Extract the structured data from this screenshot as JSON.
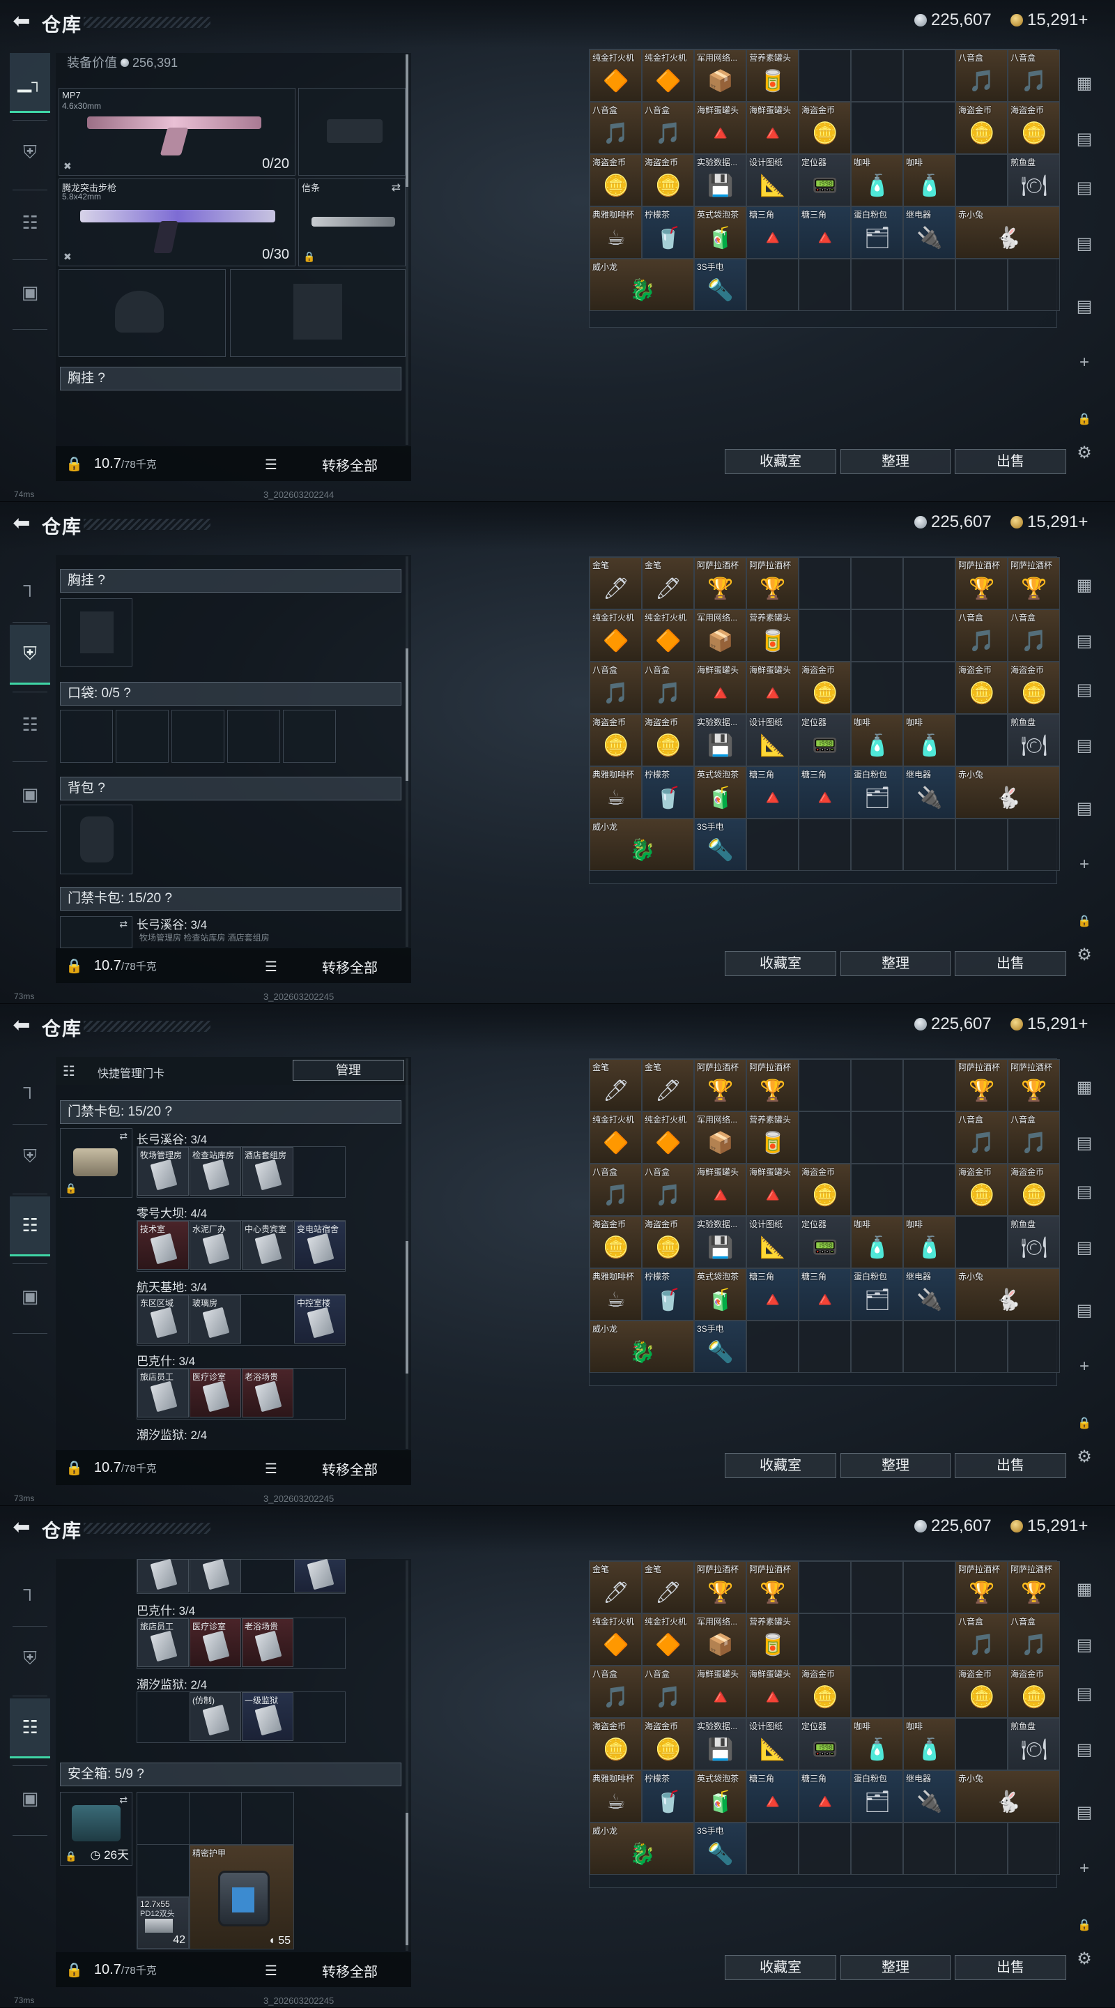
{
  "app": {
    "title": "仓库",
    "currency_silver": "225,607",
    "currency_gold": "15,291+",
    "fps": [
      "74ms",
      "73ms",
      "73ms",
      "73ms"
    ],
    "build": [
      "3_202603202244",
      "3_202603202245",
      "3_202603202245",
      "3_202603202245"
    ]
  },
  "left_nav": [
    "weapon-tab",
    "armor-tab",
    "clipboard-tab",
    "briefcase-tab"
  ],
  "screen1": {
    "value_label": "装备价值",
    "value": "256,391",
    "slot1_name": "MP7",
    "slot1_ammo_type": "4.6x30mm",
    "slot1_ammo": "0/20",
    "slot2_name": "腾龙突击步枪",
    "slot2_ammo_type": "5.8x42mm",
    "slot2_ammo": "0/30",
    "knife_name": "信条",
    "chest_label": "胸挂 ?"
  },
  "screen2": {
    "chest_label": "胸挂 ?",
    "pocket_label": "口袋: 0/5 ?",
    "backpack_label": "背包 ?",
    "card_label": "门禁卡包: 15/20 ?",
    "sub_label": "长弓溪谷: 3/4",
    "sub_cards": "牧场管理房  检查站库房  酒店套组房"
  },
  "screen3": {
    "quick_label": "快捷管理门卡",
    "manage_btn": "管理",
    "card_label": "门禁卡包: 15/20 ?",
    "groups": [
      {
        "name": "长弓溪谷: 3/4",
        "cards": [
          "牧场管理房",
          "检查站库房",
          "酒店套组房"
        ],
        "kinds": [
          "white",
          "white",
          "white"
        ]
      },
      {
        "name": "零号大坝: 4/4",
        "cards": [
          "技术室",
          "水泥厂办",
          "中心贵宾室",
          "变电站宿舍"
        ],
        "kinds": [
          "red",
          "white",
          "white",
          "blue"
        ]
      },
      {
        "name": "航天基地: 3/4",
        "cards": [
          "东区区域",
          "玻璃房",
          "",
          "中控室楼"
        ],
        "kinds": [
          "white",
          "white",
          "",
          "blue"
        ]
      },
      {
        "name": "巴克什: 3/4",
        "cards": [
          "旅店员工",
          "医疗诊室",
          "老浴场贵"
        ],
        "kinds": [
          "white",
          "red",
          "red"
        ]
      },
      {
        "name": "潮汐监狱: 2/4",
        "cards": [],
        "kinds": []
      }
    ]
  },
  "screen4": {
    "bakeshi_label": "巴克什: 3/4",
    "bakeshi_cards": [
      "旅店员工",
      "医疗诊室",
      "老浴场贵"
    ],
    "chaoxi_label": "潮汐监狱: 2/4",
    "chaoxi_cards": [
      "(仿制)",
      "一级监狱"
    ],
    "safe_label": "安全箱: 5/9 ?",
    "safe_days": "26天",
    "armor_name": "精密护甲",
    "armor_value": "55",
    "ammo_name": "12.7x55",
    "ammo_sub": "PD12双头",
    "ammo_count": "42"
  },
  "bottom": {
    "weight": "10.7",
    "weight_max": "/78千克",
    "transfer_all": "转移全部"
  },
  "stash_buttons": {
    "collection": "收藏室",
    "sort": "整理",
    "sell": "出售"
  },
  "stash_rows": [
    [
      {
        "label": "金笔",
        "kind": "gold",
        "icon": "🖊"
      },
      {
        "label": "金笔",
        "kind": "gold",
        "icon": "🖊"
      },
      {
        "label": "阿萨拉酒杯",
        "kind": "gold",
        "icon": "🏆"
      },
      {
        "label": "阿萨拉酒杯",
        "kind": "gold",
        "icon": "🏆"
      },
      {
        "label": "",
        "kind": "dark",
        "icon": ""
      },
      {
        "label": "",
        "kind": "dark",
        "icon": ""
      },
      {
        "label": "",
        "kind": "dark",
        "icon": ""
      },
      {
        "label": "阿萨拉酒杯",
        "kind": "gold",
        "icon": "🏆"
      },
      {
        "label": "阿萨拉酒杯",
        "kind": "gold",
        "icon": "🏆"
      }
    ],
    [
      {
        "label": "纯金打火机",
        "kind": "gold",
        "icon": "🔶"
      },
      {
        "label": "纯金打火机",
        "kind": "gold",
        "icon": "🔶"
      },
      {
        "label": "军用网络...",
        "kind": "gold",
        "icon": "📦"
      },
      {
        "label": "营养素罐头",
        "kind": "gold",
        "icon": "🥫"
      },
      {
        "label": "",
        "kind": "dark",
        "icon": ""
      },
      {
        "label": "",
        "kind": "dark",
        "icon": ""
      },
      {
        "label": "",
        "kind": "dark",
        "icon": ""
      },
      {
        "label": "八音盒",
        "kind": "gold",
        "icon": "🎵"
      },
      {
        "label": "八音盒",
        "kind": "gold",
        "icon": "🎵"
      }
    ],
    [
      {
        "label": "八音盒",
        "kind": "gold",
        "icon": "🎵"
      },
      {
        "label": "八音盒",
        "kind": "gold",
        "icon": "🎵"
      },
      {
        "label": "海鲜蛋罐头",
        "kind": "gold",
        "icon": "🔺"
      },
      {
        "label": "海鲜蛋罐头",
        "kind": "gold",
        "icon": "🔺"
      },
      {
        "label": "海盗金币",
        "kind": "gold",
        "icon": "🪙"
      },
      {
        "label": "",
        "kind": "dark",
        "icon": ""
      },
      {
        "label": "",
        "kind": "dark",
        "icon": ""
      },
      {
        "label": "海盗金币",
        "kind": "gold",
        "icon": "🪙"
      },
      {
        "label": "海盗金币",
        "kind": "gold",
        "icon": "🪙"
      }
    ],
    [
      {
        "label": "海盗金币",
        "kind": "gold",
        "icon": "🪙"
      },
      {
        "label": "海盗金币",
        "kind": "gold",
        "icon": "🪙"
      },
      {
        "label": "实验数据...",
        "kind": "white",
        "icon": "💾"
      },
      {
        "label": "设计图纸",
        "kind": "white",
        "icon": "📐"
      },
      {
        "label": "定位器",
        "kind": "white",
        "icon": "📟"
      },
      {
        "label": "咖啡",
        "kind": "gold",
        "icon": "🧴"
      },
      {
        "label": "咖啡",
        "kind": "gold",
        "icon": "🧴"
      },
      {
        "label": "",
        "kind": "dark",
        "icon": ""
      },
      {
        "label": "煎鱼盘",
        "kind": "white",
        "icon": "🍽"
      }
    ],
    [
      {
        "label": "典雅咖啡杯",
        "kind": "gold",
        "icon": "☕"
      },
      {
        "label": "柠檬茶",
        "kind": "blue",
        "icon": "🥤"
      },
      {
        "label": "英式袋泡茶",
        "kind": "gold",
        "icon": "🧃"
      },
      {
        "label": "糖三角",
        "kind": "blue",
        "icon": "🔺"
      },
      {
        "label": "糖三角",
        "kind": "blue",
        "icon": "🔺"
      },
      {
        "label": "蛋白粉包",
        "kind": "blue",
        "icon": "🗂"
      },
      {
        "label": "继电器",
        "kind": "blue",
        "icon": "🔌"
      },
      {
        "label": "赤小兔",
        "kind": "gold",
        "icon": "🐇",
        "wide": true
      }
    ],
    [
      {
        "label": "威小龙",
        "kind": "gold",
        "icon": "🐉",
        "wide": true
      },
      {
        "label": "3S手电",
        "kind": "blue",
        "icon": "🔦"
      }
    ]
  ],
  "colors": {
    "accent_green": "#3fd6a6",
    "gold_cell": "#4a3a28",
    "blue_cell": "#23384e"
  }
}
